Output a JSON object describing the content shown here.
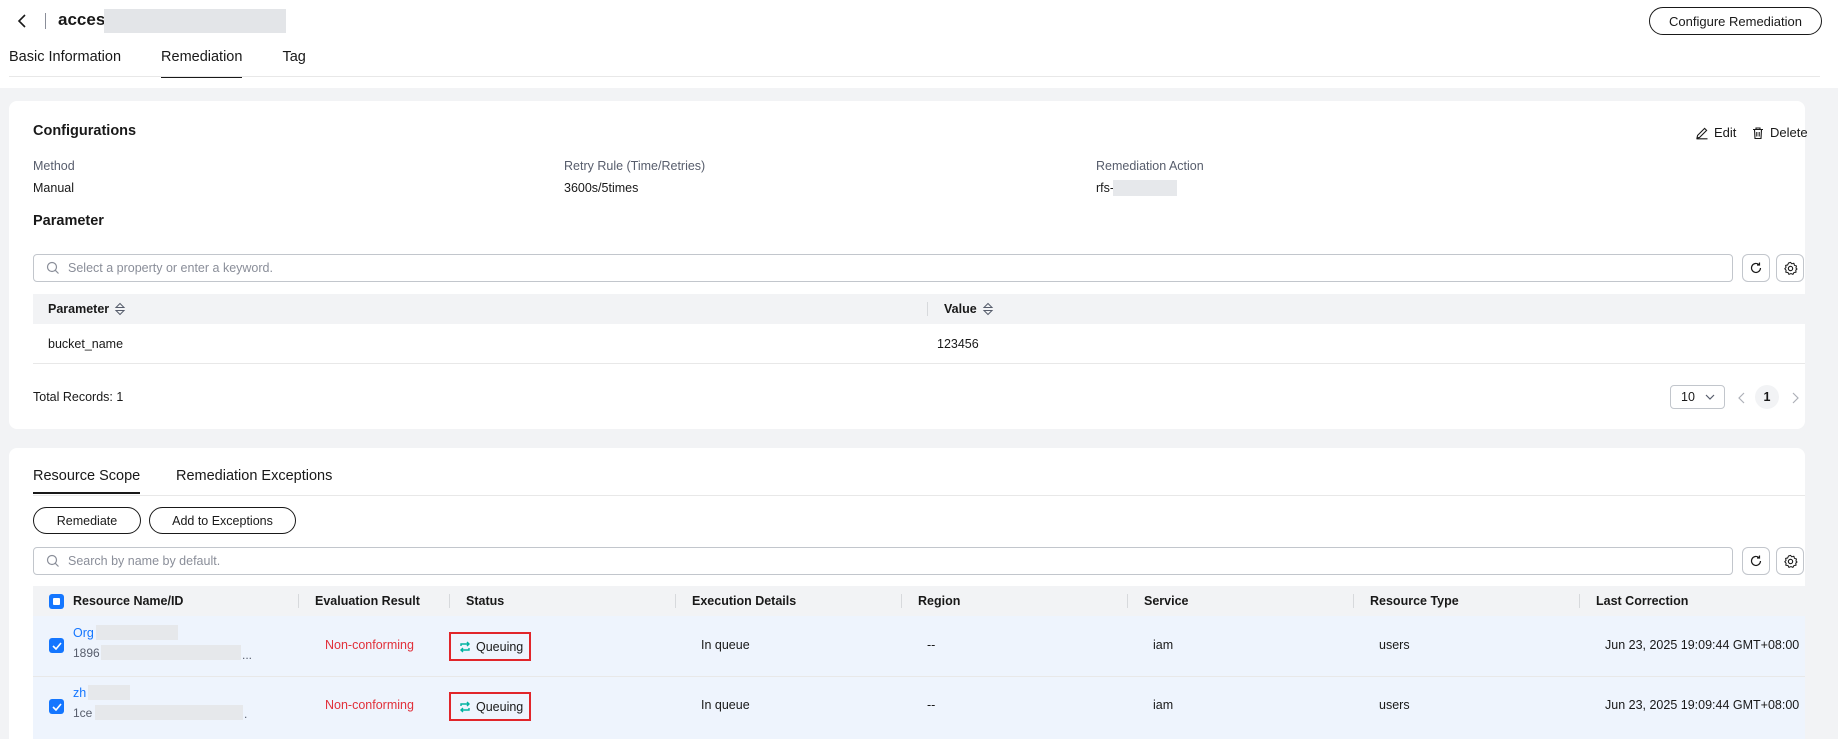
{
  "header": {
    "title": "access",
    "configure_button": "Configure Remediation"
  },
  "tabs": [
    "Basic Information",
    "Remediation",
    "Tag"
  ],
  "configurations": {
    "title": "Configurations",
    "edit_label": "Edit",
    "delete_label": "Delete",
    "method_label": "Method",
    "method_value": "Manual",
    "retry_label": "Retry Rule (Time/Retries)",
    "retry_value": "3600s/5times",
    "action_label": "Remediation Action",
    "action_value": "rfs-"
  },
  "parameter": {
    "title": "Parameter",
    "search_placeholder": "Select a property or enter a keyword.",
    "columns": [
      "Parameter",
      "Value"
    ],
    "rows": [
      {
        "parameter": "bucket_name",
        "value": "123456"
      }
    ],
    "total_records": "Total Records: 1",
    "page_size": "10",
    "current_page": "1"
  },
  "resources": {
    "tabs": [
      "Resource Scope",
      "Remediation Exceptions"
    ],
    "remediate_button": "Remediate",
    "exceptions_button": "Add to Exceptions",
    "search_placeholder": "Search by name by default.",
    "columns": [
      "Resource Name/ID",
      "Evaluation Result",
      "Status",
      "Execution Details",
      "Region",
      "Service",
      "Resource Type",
      "Last Correction"
    ],
    "rows": [
      {
        "name": "Org",
        "id": "1896",
        "id_suffix": "...",
        "evaluation": "Non-conforming",
        "status": "Queuing",
        "details": "In queue",
        "region": "--",
        "service": "iam",
        "type": "users",
        "last_correction": "Jun 23, 2025 19:09:44 GMT+08:00"
      },
      {
        "name": "zh",
        "id": "1ce",
        "id_suffix": ".",
        "evaluation": "Non-conforming",
        "status": "Queuing",
        "details": "In queue",
        "region": "--",
        "service": "iam",
        "type": "users",
        "last_correction": "Jun 23, 2025 19:09:44 GMT+08:00"
      }
    ]
  },
  "colors": {
    "accent": "#1476ff",
    "danger": "#e1303a",
    "status_icon": "#00b3a1",
    "highlight_border": "#e1252a"
  }
}
